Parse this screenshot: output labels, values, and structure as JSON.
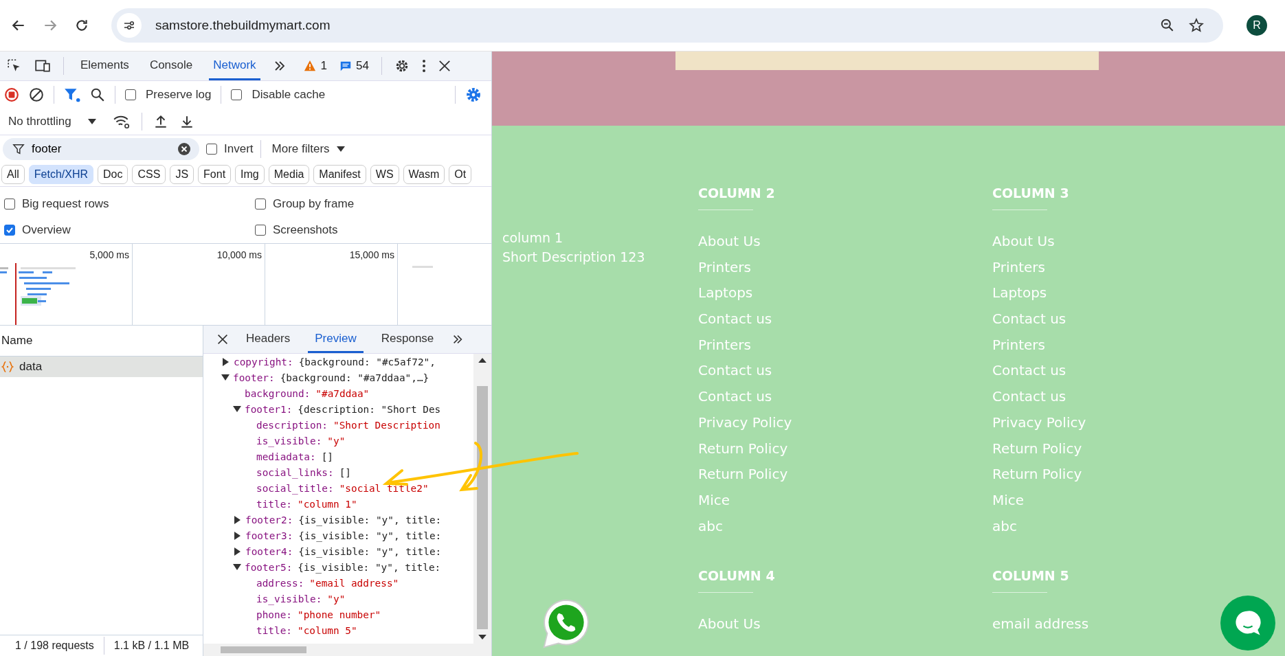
{
  "browser": {
    "url": "samstore.thebuildmymart.com",
    "profile_initial": "R"
  },
  "devtools": {
    "tabs": [
      {
        "label": "Elements",
        "selected": false
      },
      {
        "label": "Console",
        "selected": false
      },
      {
        "label": "Network",
        "selected": true
      }
    ],
    "warnings": "1",
    "messages": "54",
    "recording": true,
    "toolbar_checkboxes": [
      {
        "label": "Preserve log",
        "checked": false
      },
      {
        "label": "Disable cache",
        "checked": false
      }
    ],
    "throttling": "No throttling",
    "filter": {
      "value": "footer"
    },
    "invert": {
      "label": "Invert",
      "checked": false
    },
    "more_filters": "More filters",
    "type_filters": [
      {
        "label": "All",
        "selected": false
      },
      {
        "label": "Fetch/XHR",
        "selected": true
      },
      {
        "label": "Doc",
        "selected": false
      },
      {
        "label": "CSS",
        "selected": false
      },
      {
        "label": "JS",
        "selected": false
      },
      {
        "label": "Font",
        "selected": false
      },
      {
        "label": "Img",
        "selected": false
      },
      {
        "label": "Media",
        "selected": false
      },
      {
        "label": "Manifest",
        "selected": false
      },
      {
        "label": "WS",
        "selected": false
      },
      {
        "label": "Wasm",
        "selected": false
      },
      {
        "label": "Ot",
        "selected": false
      }
    ],
    "options": [
      {
        "label": "Big request rows",
        "checked": false
      },
      {
        "label": "Group by frame",
        "checked": false
      },
      {
        "label": "Overview",
        "checked": true
      },
      {
        "label": "Screenshots",
        "checked": false
      }
    ],
    "timeline_ticks": [
      "5,000 ms",
      "10,000 ms",
      "15,000 ms"
    ],
    "requests": {
      "header": "Name",
      "rows": [
        {
          "name": "data",
          "selected": true
        }
      ]
    },
    "detail_tabs": [
      {
        "label": "Headers",
        "selected": false
      },
      {
        "label": "Preview",
        "selected": true
      },
      {
        "label": "Response",
        "selected": false
      }
    ],
    "preview_tree": [
      {
        "key": "copyright:",
        "kind": "object",
        "summary": "{background: \"#c5af72\",",
        "expanded": false
      },
      {
        "key": "footer:",
        "kind": "object",
        "summary": "{background: \"#a7ddaa\",…}",
        "expanded": true,
        "children": [
          {
            "key": "background:",
            "kind": "string",
            "value": "\"#a7ddaa\""
          },
          {
            "key": "footer1:",
            "kind": "object",
            "summary": "{description: \"Short Des",
            "expanded": true,
            "children": [
              {
                "key": "description:",
                "kind": "string",
                "value": "\"Short Description"
              },
              {
                "key": "is_visible:",
                "kind": "string",
                "value": "\"y\""
              },
              {
                "key": "mediadata:",
                "kind": "array",
                "value": "[]"
              },
              {
                "key": "social_links:",
                "kind": "array",
                "value": "[]"
              },
              {
                "key": "social_title:",
                "kind": "string",
                "value": "\"social title2\""
              },
              {
                "key": "title:",
                "kind": "string",
                "value": "\"column 1\""
              }
            ]
          },
          {
            "key": "footer2:",
            "kind": "object",
            "summary": "{is_visible: \"y\", title:",
            "expanded": false
          },
          {
            "key": "footer3:",
            "kind": "object",
            "summary": "{is_visible: \"y\", title:",
            "expanded": false
          },
          {
            "key": "footer4:",
            "kind": "object",
            "summary": "{is_visible: \"y\", title:",
            "expanded": false
          },
          {
            "key": "footer5:",
            "kind": "object",
            "summary": "{is_visible: \"y\", title:",
            "expanded": true,
            "children": [
              {
                "key": "address:",
                "kind": "string",
                "value": "\"email address\""
              },
              {
                "key": "is_visible:",
                "kind": "string",
                "value": "\"y\""
              },
              {
                "key": "phone:",
                "kind": "string",
                "value": "\"phone number\""
              },
              {
                "key": "title:",
                "kind": "string",
                "value": "\"column 5\""
              }
            ]
          }
        ]
      }
    ],
    "status": [
      "1 / 198 requests",
      "1.1 kB / 1.1 MB"
    ]
  },
  "page": {
    "column_1": {
      "title": "column 1",
      "description": "Short Description 123"
    },
    "columns": [
      {
        "title": "COLUMN 2",
        "links": [
          "About Us",
          "Printers",
          "Laptops",
          "Contact us",
          "Printers",
          "Contact us",
          "Contact us",
          "Privacy Policy",
          "Return Policy",
          "Return Policy",
          "Mice",
          "abc"
        ]
      },
      {
        "title": "COLUMN 3",
        "links": [
          "About Us",
          "Printers",
          "Laptops",
          "Contact us",
          "Printers",
          "Contact us",
          "Contact us",
          "Privacy Policy",
          "Return Policy",
          "Return Policy",
          "Mice",
          "abc"
        ]
      },
      {
        "title": "COLUMN 4",
        "links": [
          "About Us"
        ]
      },
      {
        "title": "COLUMN 5",
        "links": [
          "email address"
        ]
      }
    ]
  }
}
